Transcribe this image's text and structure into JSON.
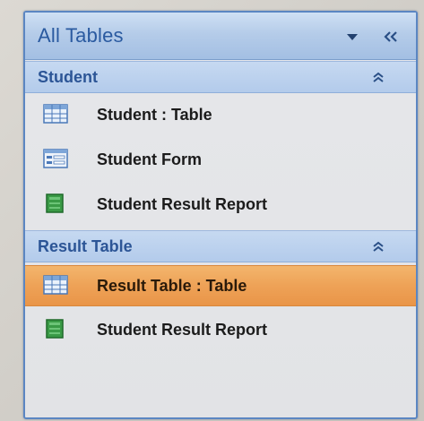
{
  "navigation_pane": {
    "title": "All Tables",
    "groups": [
      {
        "label": "Student",
        "items": [
          {
            "label": "Student : Table",
            "icon": "table-icon",
            "selected": false
          },
          {
            "label": "Student Form",
            "icon": "form-icon",
            "selected": false
          },
          {
            "label": "Student Result Report",
            "icon": "report-icon",
            "selected": false
          }
        ]
      },
      {
        "label": "Result Table",
        "items": [
          {
            "label": "Result Table : Table",
            "icon": "table-icon",
            "selected": true
          },
          {
            "label": "Student Result Report",
            "icon": "report-icon",
            "selected": false
          }
        ]
      }
    ]
  },
  "colors": {
    "header_bg": "#b5cce9",
    "group_bg": "#b3cbeb",
    "selected_bg": "#eea257",
    "accent_text": "#2c5596"
  }
}
